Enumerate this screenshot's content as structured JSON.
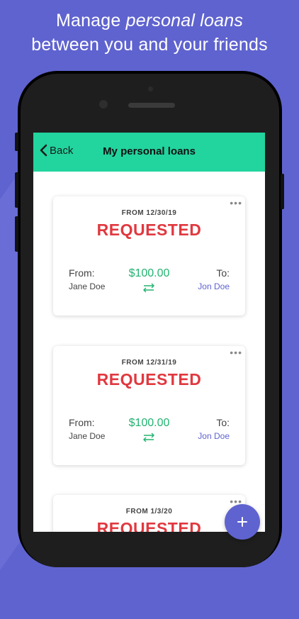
{
  "headline": {
    "line1_prefix": "Manage ",
    "line1_emphasis": "personal loans",
    "line2": "between you and your friends"
  },
  "navbar": {
    "back_label": "Back",
    "title": "My personal loans"
  },
  "loans": [
    {
      "date": "FROM 12/30/19",
      "status": "REQUESTED",
      "from_label": "From:",
      "from_name": "Jane Doe",
      "amount": "$100.00",
      "to_label": "To:",
      "to_name": "Jon Doe"
    },
    {
      "date": "FROM 12/31/19",
      "status": "REQUESTED",
      "from_label": "From:",
      "from_name": "Jane Doe",
      "amount": "$100.00",
      "to_label": "To:",
      "to_name": "Jon Doe"
    },
    {
      "date": "FROM 1/3/20",
      "status": "REQUESTED"
    }
  ],
  "menu_icon": "more-dots-icon",
  "fab": {
    "icon": "plus-icon"
  },
  "colors": {
    "background": "#5f63cf",
    "navbar": "#22d49e",
    "status_red": "#e1383f",
    "amount_green": "#22b370",
    "link_purple": "#5f63cf"
  }
}
